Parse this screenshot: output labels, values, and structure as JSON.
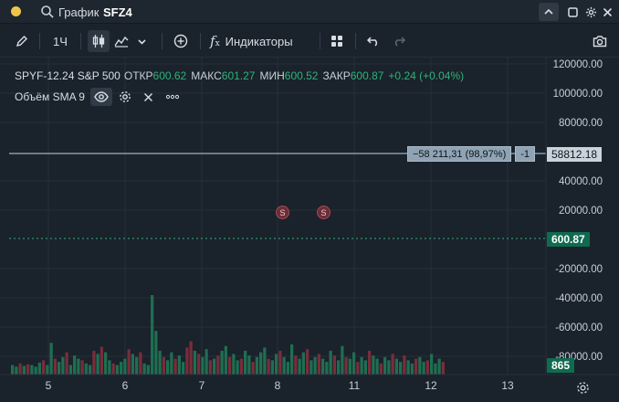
{
  "titlebar": {
    "label": "График",
    "symbol": "SFZ4",
    "colors": {
      "dot": "#f0c64a"
    }
  },
  "toolbar": {
    "interval": "1Ч",
    "indicators_label": "Индикаторы"
  },
  "legend": {
    "symbol": "SPYF-12.24 S&P 500",
    "open_key": "ОТКР",
    "open_value": "600.62",
    "high_key": "МАКС",
    "high_value": "601.27",
    "low_key": "МИН",
    "low_value": "600.52",
    "close_key": "ЗАКР",
    "close_value": "600.87",
    "change": "+0.24 (+0.04%)"
  },
  "volume_indicator": {
    "label": "Объём SMA 9"
  },
  "position": {
    "pnl": "−58 211,31 (98,97%)",
    "qty": "-1",
    "price": "58812.18"
  },
  "last_price": "600.87",
  "last_volume": "865",
  "markers": [
    "S",
    "S"
  ],
  "chart_data": {
    "type": "bar",
    "price_axis_ticks": [
      "120000.00",
      "100000.00",
      "80000.00",
      "40000.00",
      "20000.00",
      "-20000.00",
      "-40000.00",
      "-60000.00",
      "-80000.00"
    ],
    "time_axis_ticks": [
      "5",
      "6",
      "7",
      "8",
      "11",
      "12",
      "13"
    ],
    "volume_bars": [
      {
        "v": 0.12,
        "up": true
      },
      {
        "v": 0.1,
        "up": true
      },
      {
        "v": 0.14,
        "up": false
      },
      {
        "v": 0.11,
        "up": true
      },
      {
        "v": 0.13,
        "up": false
      },
      {
        "v": 0.12,
        "up": true
      },
      {
        "v": 0.1,
        "up": true
      },
      {
        "v": 0.15,
        "up": true
      },
      {
        "v": 0.18,
        "up": false
      },
      {
        "v": 0.12,
        "up": true
      },
      {
        "v": 0.4,
        "up": true
      },
      {
        "v": 0.2,
        "up": false
      },
      {
        "v": 0.16,
        "up": true
      },
      {
        "v": 0.22,
        "up": true
      },
      {
        "v": 0.28,
        "up": false
      },
      {
        "v": 0.12,
        "up": true
      },
      {
        "v": 0.24,
        "up": true
      },
      {
        "v": 0.2,
        "up": true
      },
      {
        "v": 0.18,
        "up": false
      },
      {
        "v": 0.14,
        "up": true
      },
      {
        "v": 0.12,
        "up": true
      },
      {
        "v": 0.3,
        "up": false
      },
      {
        "v": 0.26,
        "up": true
      },
      {
        "v": 0.35,
        "up": false
      },
      {
        "v": 0.28,
        "up": true
      },
      {
        "v": 0.18,
        "up": true
      },
      {
        "v": 0.14,
        "up": false
      },
      {
        "v": 0.12,
        "up": true
      },
      {
        "v": 0.16,
        "up": true
      },
      {
        "v": 0.2,
        "up": true
      },
      {
        "v": 0.32,
        "up": false
      },
      {
        "v": 0.26,
        "up": true
      },
      {
        "v": 0.22,
        "up": true
      },
      {
        "v": 0.28,
        "up": false
      },
      {
        "v": 0.14,
        "up": true
      },
      {
        "v": 0.12,
        "up": true
      },
      {
        "v": 1.0,
        "up": true
      },
      {
        "v": 0.55,
        "up": true
      },
      {
        "v": 0.3,
        "up": true
      },
      {
        "v": 0.22,
        "up": false
      },
      {
        "v": 0.18,
        "up": true
      },
      {
        "v": 0.28,
        "up": true
      },
      {
        "v": 0.2,
        "up": false
      },
      {
        "v": 0.24,
        "up": true
      },
      {
        "v": 0.16,
        "up": true
      },
      {
        "v": 0.34,
        "up": false
      },
      {
        "v": 0.42,
        "up": false
      },
      {
        "v": 0.3,
        "up": true
      },
      {
        "v": 0.26,
        "up": false
      },
      {
        "v": 0.22,
        "up": true
      },
      {
        "v": 0.32,
        "up": true
      },
      {
        "v": 0.18,
        "up": false
      },
      {
        "v": 0.2,
        "up": true
      },
      {
        "v": 0.24,
        "up": false
      },
      {
        "v": 0.3,
        "up": true
      },
      {
        "v": 0.36,
        "up": true
      },
      {
        "v": 0.22,
        "up": false
      },
      {
        "v": 0.26,
        "up": true
      },
      {
        "v": 0.18,
        "up": true
      },
      {
        "v": 0.2,
        "up": false
      },
      {
        "v": 0.3,
        "up": true
      },
      {
        "v": 0.24,
        "up": true
      },
      {
        "v": 0.16,
        "up": false
      },
      {
        "v": 0.22,
        "up": true
      },
      {
        "v": 0.28,
        "up": true
      },
      {
        "v": 0.34,
        "up": true
      },
      {
        "v": 0.2,
        "up": false
      },
      {
        "v": 0.18,
        "up": true
      },
      {
        "v": 0.26,
        "up": true
      },
      {
        "v": 0.3,
        "up": false
      },
      {
        "v": 0.22,
        "up": true
      },
      {
        "v": 0.16,
        "up": true
      },
      {
        "v": 0.38,
        "up": true
      },
      {
        "v": 0.24,
        "up": false
      },
      {
        "v": 0.2,
        "up": true
      },
      {
        "v": 0.28,
        "up": true
      },
      {
        "v": 0.32,
        "up": false
      },
      {
        "v": 0.18,
        "up": true
      },
      {
        "v": 0.22,
        "up": true
      },
      {
        "v": 0.26,
        "up": false
      },
      {
        "v": 0.2,
        "up": true
      },
      {
        "v": 0.16,
        "up": true
      },
      {
        "v": 0.3,
        "up": true
      },
      {
        "v": 0.24,
        "up": false
      },
      {
        "v": 0.18,
        "up": true
      },
      {
        "v": 0.36,
        "up": true
      },
      {
        "v": 0.22,
        "up": false
      },
      {
        "v": 0.2,
        "up": true
      },
      {
        "v": 0.28,
        "up": true
      },
      {
        "v": 0.16,
        "up": false
      },
      {
        "v": 0.22,
        "up": true
      },
      {
        "v": 0.18,
        "up": true
      },
      {
        "v": 0.3,
        "up": false
      },
      {
        "v": 0.24,
        "up": true
      },
      {
        "v": 0.2,
        "up": true
      },
      {
        "v": 0.14,
        "up": false
      },
      {
        "v": 0.22,
        "up": true
      },
      {
        "v": 0.18,
        "up": true
      },
      {
        "v": 0.26,
        "up": false
      },
      {
        "v": 0.2,
        "up": true
      },
      {
        "v": 0.16,
        "up": true
      },
      {
        "v": 0.24,
        "up": false
      },
      {
        "v": 0.18,
        "up": true
      },
      {
        "v": 0.14,
        "up": true
      },
      {
        "v": 0.2,
        "up": false
      },
      {
        "v": 0.22,
        "up": true
      },
      {
        "v": 0.16,
        "up": true
      },
      {
        "v": 0.18,
        "up": false
      },
      {
        "v": 0.26,
        "up": true
      },
      {
        "v": 0.14,
        "up": true
      },
      {
        "v": 0.2,
        "up": true
      },
      {
        "v": 0.16,
        "up": false
      }
    ],
    "colors": {
      "up": "#1f6e52",
      "down": "#7a2d3a",
      "grid": "#26303a",
      "axis_text": "#c8cfd6",
      "position_line": "#9fb1c1",
      "last_price_line": "#2fb37a"
    }
  }
}
